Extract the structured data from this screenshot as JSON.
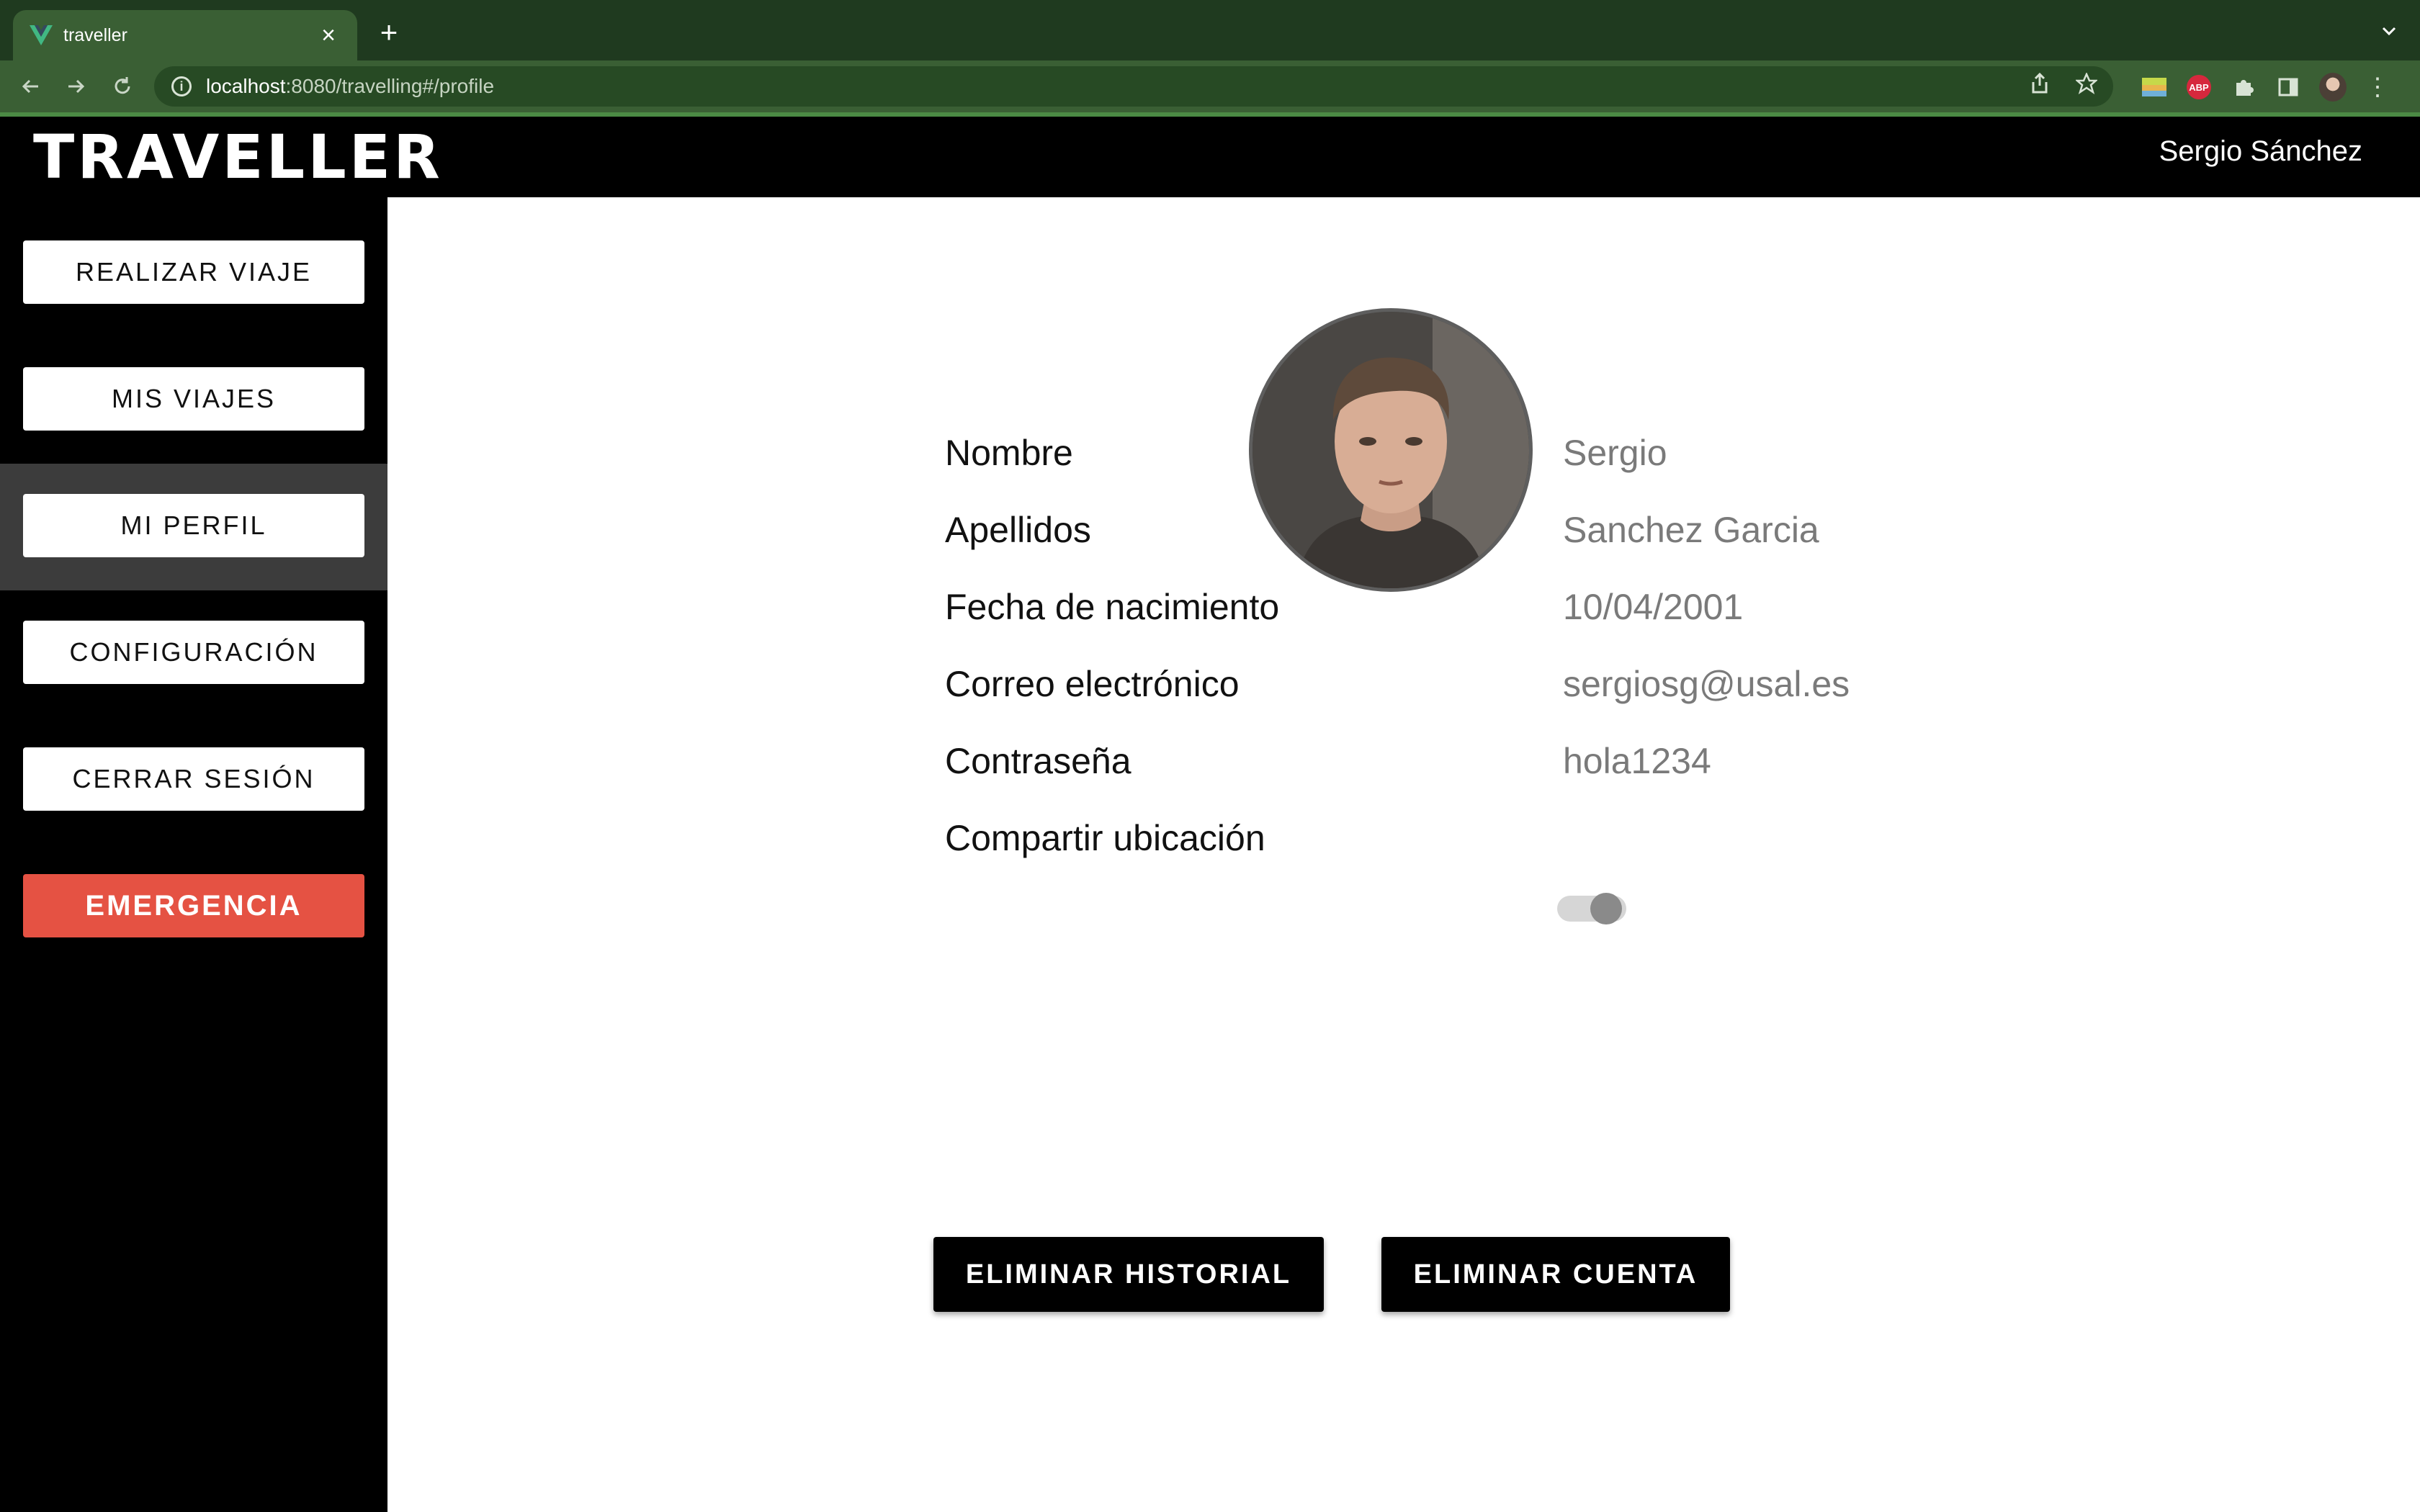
{
  "browser": {
    "tab_title": "traveller",
    "url_host": "localhost",
    "url_rest": ":8080/travelling#/profile"
  },
  "header": {
    "logo": "TRAVELLER",
    "user_name": "Sergio Sánchez"
  },
  "sidebar": {
    "items": [
      {
        "label": "REALIZAR VIAJE"
      },
      {
        "label": "MIS VIAJES"
      },
      {
        "label": "MI PERFIL",
        "active": true
      },
      {
        "label": "CONFIGURACIÓN"
      },
      {
        "label": "CERRAR SESIÓN"
      },
      {
        "label": "EMERGENCIA",
        "color": "#e55243"
      }
    ]
  },
  "profile": {
    "fields": [
      {
        "label": "Nombre",
        "value": "Sergio"
      },
      {
        "label": "Apellidos",
        "value": "Sanchez Garcia"
      },
      {
        "label": "Fecha de nacimiento",
        "value": "10/04/2001"
      },
      {
        "label": "Correo electrónico",
        "value": "sergiosg@usal.es"
      },
      {
        "label": "Contraseña",
        "value": "hola1234"
      }
    ],
    "share_location": {
      "label": "Compartir ubicación",
      "enabled": false
    },
    "buttons": {
      "delete_history": "ELIMINAR HISTORIAL",
      "delete_account": "ELIMINAR CUENTA"
    }
  },
  "icons": {
    "favicon": "vue-logo-icon",
    "extensions": [
      "extension-color-icon",
      "adblock-plus-icon",
      "puzzle-extensions-icon",
      "side-panel-icon"
    ]
  }
}
